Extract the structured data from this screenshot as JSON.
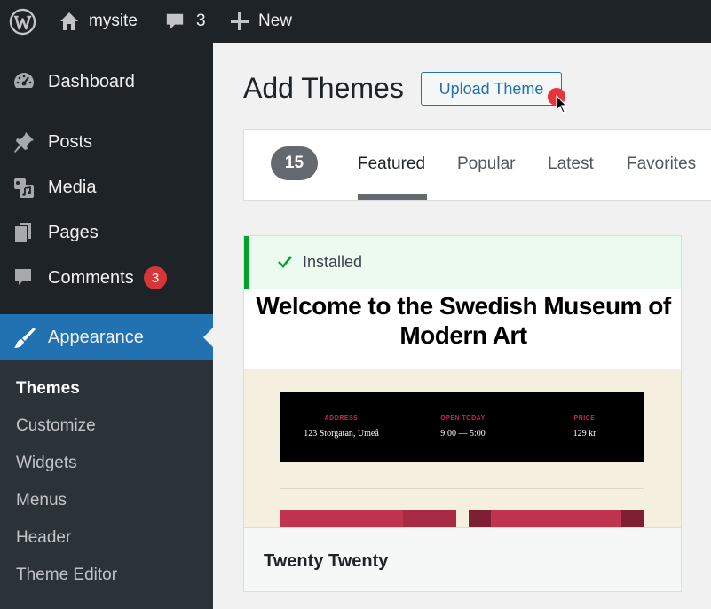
{
  "adminbar": {
    "site_name": "mysite",
    "comments_count": "3",
    "new_label": "New",
    "icons": [
      "wordpress-logo-icon",
      "home-icon",
      "comment-bubble-icon",
      "plus-icon"
    ]
  },
  "sidebar": {
    "items": [
      {
        "label": "Dashboard",
        "icon": "dashboard-icon"
      },
      {
        "label": "Posts",
        "icon": "pushpin-icon"
      },
      {
        "label": "Media",
        "icon": "media-icon"
      },
      {
        "label": "Pages",
        "icon": "pages-icon"
      },
      {
        "label": "Comments",
        "icon": "comment-icon",
        "badge": "3"
      },
      {
        "label": "Appearance",
        "icon": "paintbrush-icon"
      }
    ],
    "submenu": [
      "Themes",
      "Customize",
      "Widgets",
      "Menus",
      "Header",
      "Theme Editor"
    ]
  },
  "main": {
    "title": "Add Themes",
    "upload_button": "Upload Theme",
    "filter": {
      "count": "15",
      "tabs": [
        "Featured",
        "Popular",
        "Latest",
        "Favorites"
      ],
      "active_tab": "Featured"
    },
    "theme": {
      "status": "Installed",
      "screenshot_title": "Welcome to the Swedish Museum of Modern Art",
      "info": [
        {
          "label": "ADDRESS",
          "value": "123 Storgatan, Umeå"
        },
        {
          "label": "OPEN TODAY",
          "value": "9:00 — 5:00"
        },
        {
          "label": "PRICE",
          "value": "129 kr"
        }
      ],
      "name": "Twenty Twenty"
    }
  },
  "colors": {
    "adminbar_bg": "#1d2327",
    "accent": "#2271b1",
    "badge": "#d63638",
    "installed_bg": "#edfaef",
    "installed_border": "#00a32a",
    "theme_accent": "#cd2653"
  }
}
